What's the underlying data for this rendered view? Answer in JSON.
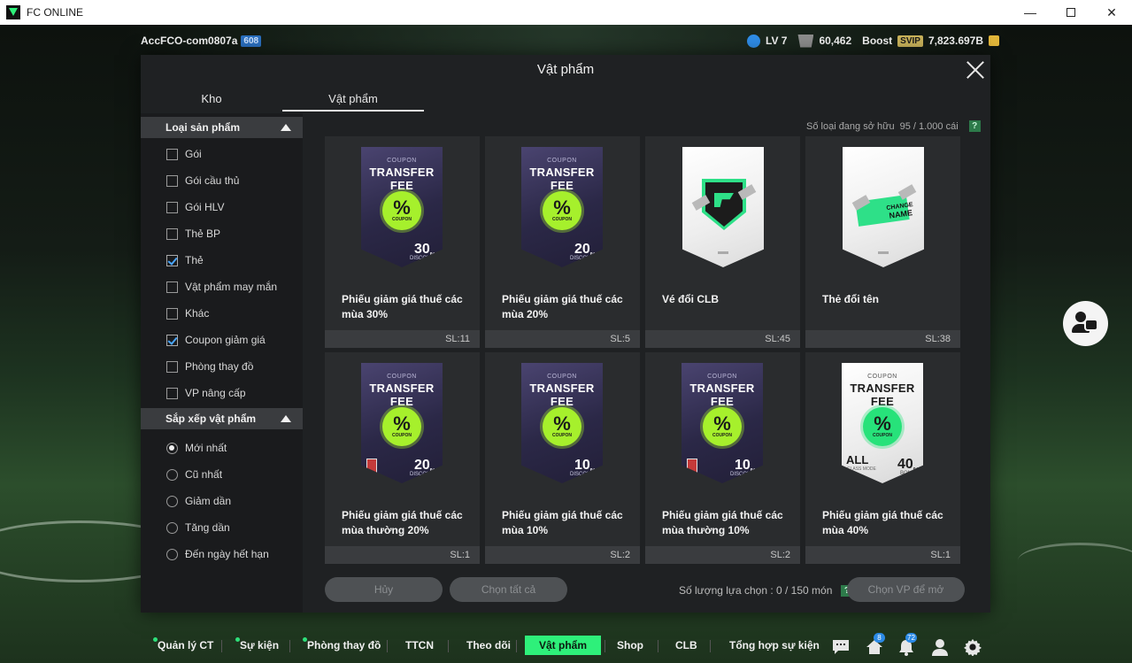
{
  "window": {
    "title": "FC ONLINE",
    "controls": {
      "minimize": "—",
      "restore": "",
      "close": "✕"
    }
  },
  "hud": {
    "account_name": "AccFCO-com0807a",
    "account_badge": "608",
    "level": "LV 7",
    "coins": "60,462",
    "boost_label": "Boost",
    "svip_label": "SVIP",
    "bp": "7,823.697B"
  },
  "modal": {
    "title": "Vật phẩm",
    "tabs": [
      {
        "label": "Kho",
        "active": false
      },
      {
        "label": "Vật phẩm",
        "active": true
      }
    ],
    "filter": {
      "product_type_header": "Loại sản phẩm",
      "product_types": [
        {
          "label": "Gói",
          "checked": false
        },
        {
          "label": "Gói cầu thủ",
          "checked": false
        },
        {
          "label": "Gói HLV",
          "checked": false
        },
        {
          "label": "Thẻ BP",
          "checked": false
        },
        {
          "label": "Thẻ",
          "checked": true
        },
        {
          "label": "Vật phẩm may mắn",
          "checked": false
        },
        {
          "label": "Khác",
          "checked": false
        },
        {
          "label": "Coupon giảm giá",
          "checked": true
        },
        {
          "label": "Phòng thay đồ",
          "checked": false
        },
        {
          "label": "VP nâng cấp",
          "checked": false
        }
      ],
      "sort_header": "Sắp xếp vật phẩm",
      "sort_options": [
        {
          "label": "Mới nhất",
          "selected": true
        },
        {
          "label": "Cũ nhất",
          "selected": false
        },
        {
          "label": "Giảm dần",
          "selected": false
        },
        {
          "label": "Tăng dần",
          "selected": false
        },
        {
          "label": "Đến ngày hết hạn",
          "selected": false
        }
      ]
    },
    "owned_label": "Số loại đang sở hữu",
    "owned_value": "95 / 1.000 cái",
    "help": "?",
    "items": [
      {
        "name": "Phiếu giảm giá thuế các mùa 30%",
        "qty": "SL:11",
        "art": "coupon-dark",
        "percent": "30",
        "locked": false
      },
      {
        "name": "Phiếu giảm giá thuế các mùa 20%",
        "qty": "SL:5",
        "art": "coupon-dark",
        "percent": "20",
        "locked": false
      },
      {
        "name": "Vé đổi CLB",
        "qty": "SL:45",
        "art": "club-ticket",
        "percent": "",
        "locked": false
      },
      {
        "name": "Thẻ đổi tên",
        "qty": "SL:38",
        "art": "name-change",
        "percent": "",
        "locked": false
      },
      {
        "name": "Phiếu giảm giá thuế các mùa thường 20%",
        "qty": "SL:1",
        "art": "coupon-dark",
        "percent": "20",
        "locked": true
      },
      {
        "name": "Phiếu giảm giá thuế các mùa 10%",
        "qty": "SL:2",
        "art": "coupon-dark",
        "percent": "10",
        "locked": false
      },
      {
        "name": "Phiếu giảm giá thuế các mùa thường 10%",
        "qty": "SL:2",
        "art": "coupon-dark",
        "percent": "10",
        "locked": true
      },
      {
        "name": "Phiếu giảm giá thuế các mùa 40%",
        "qty": "SL:1",
        "art": "coupon-white",
        "percent": "40",
        "locked": false
      }
    ],
    "coupon_art": {
      "small": "COUPON",
      "title": "TRANSFER FEE",
      "seal": "%",
      "seal_sub": "COUPON",
      "percent_unit": "%",
      "discount": "DISCOUNT",
      "bonus": "BONUS",
      "all": "ALL",
      "all_sub": "CLASS MODE"
    },
    "name_change_art": {
      "small": "CHANGE",
      "big": "NAME"
    },
    "buttons": {
      "cancel": "Hủy",
      "select_all": "Chọn tất cả",
      "select_count_label": "Số lượng lựa chọn : 0 / 150 món",
      "open": "Chọn VP để mở"
    }
  },
  "bottom_nav": {
    "items": [
      {
        "label": "Quản lý CT",
        "dot": true
      },
      {
        "label": "Sự kiện",
        "dot": true
      },
      {
        "label": "Phòng thay đồ",
        "dot": true
      },
      {
        "label": "TTCN",
        "dot": false
      },
      {
        "label": "Theo dõi",
        "dot": false
      },
      {
        "label": "Vật phẩm",
        "dot": false,
        "active": true
      },
      {
        "label": "Shop",
        "dot": false
      },
      {
        "label": "CLB",
        "dot": false
      },
      {
        "label": "Tổng hợp sự kiện",
        "dot": false
      }
    ],
    "icons": [
      {
        "name": "chat-icon",
        "badge": ""
      },
      {
        "name": "home-icon",
        "badge": "8"
      },
      {
        "name": "bell-icon",
        "badge": "72"
      },
      {
        "name": "profile-icon",
        "badge": ""
      },
      {
        "name": "settings-gear-icon",
        "badge": ""
      }
    ]
  },
  "colors": {
    "accent_green": "#2ef07a",
    "modal_bg": "#1f2123",
    "card_bg": "#2a2c2e",
    "check_blue": "#49a6ff"
  }
}
